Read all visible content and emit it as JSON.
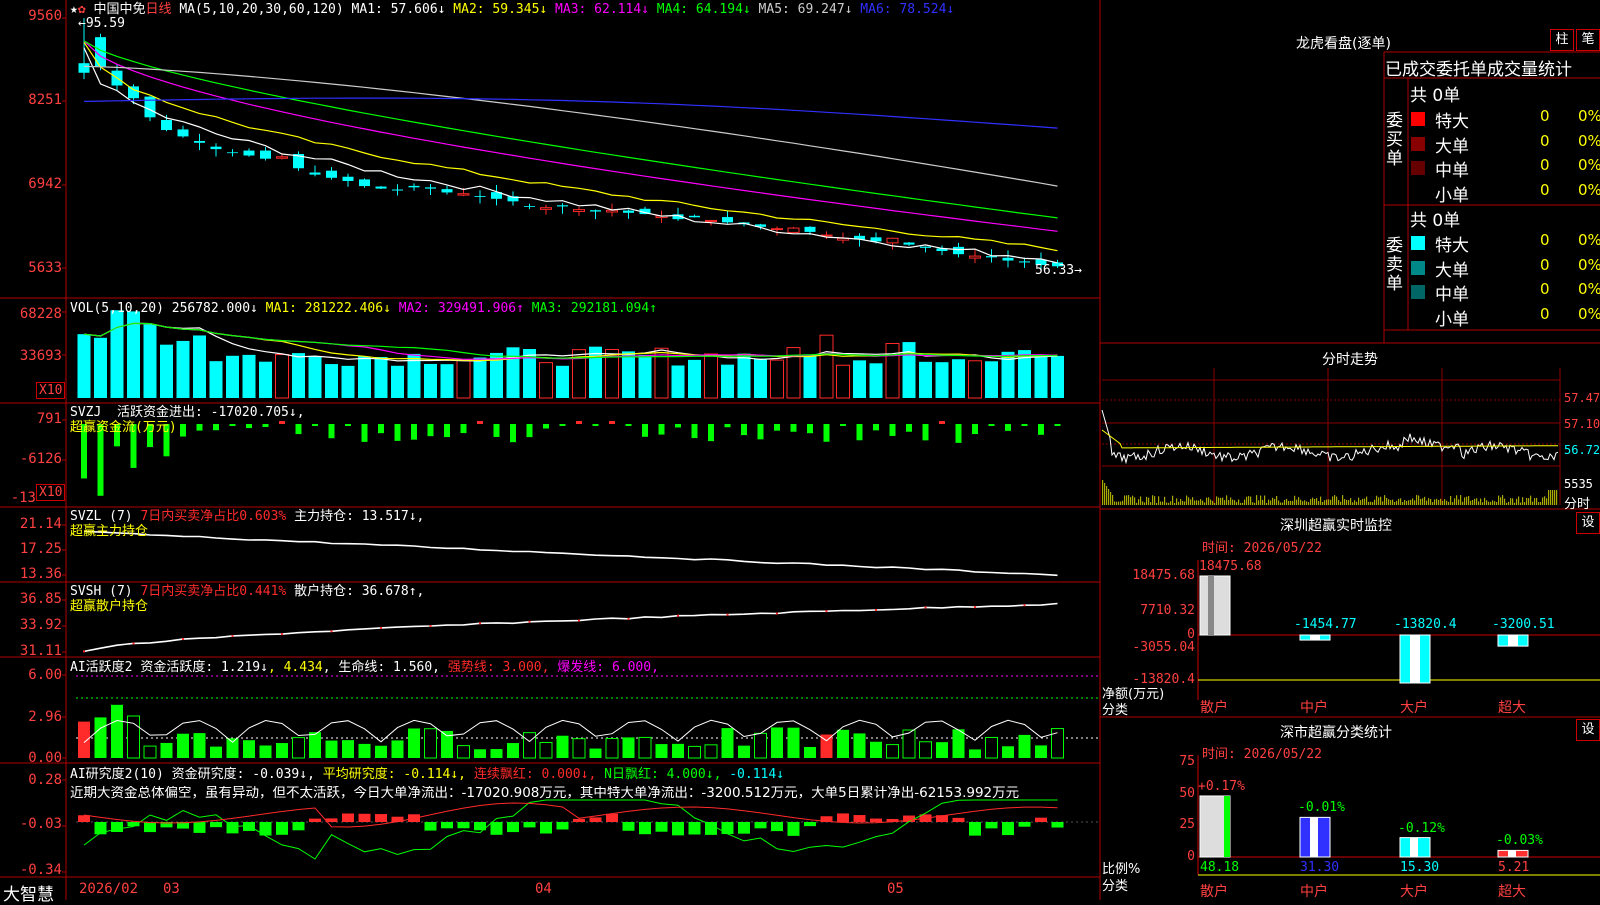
{
  "colors": {
    "up": "#ff2a2a",
    "down": "#00ffff",
    "frame": "#b00000",
    "ma1": "#ffffff",
    "ma2": "#ffff00",
    "ma3": "#ff00ff",
    "ma4": "#00ff00",
    "ma5": "#cccccc",
    "ma6": "#3030ff",
    "yellow": "#ffff00",
    "green": "#00ff00"
  },
  "main": {
    "stock_name": "中国中免",
    "period": "日线",
    "ma_label": "MA(5,10,20,30,60,120)",
    "ma1": "MA1: 57.606↓",
    "ma2": "MA2: 59.345↓",
    "ma3": "MA3: 62.114↓",
    "ma4": "MA4: 64.194↓",
    "ma5": "MA5: 69.247↓",
    "ma6": "MA6: 78.524↓",
    "high_mark": "←95.59",
    "low_mark": "56.33→",
    "yticks": [
      "9560",
      "8251",
      "6942",
      "5633"
    ]
  },
  "vol": {
    "title": "VOL(5,10,20)",
    "value": "256782.000↓",
    "ma1": "MA1: 281222.406↓",
    "ma2": "MA2: 329491.906↑",
    "ma3": "MA3: 292181.094↑",
    "yticks": [
      "68228",
      "33693"
    ],
    "unit": "X10"
  },
  "svzj": {
    "title": "SVZJ",
    "label": "活跃资金进出: -17020.705↓,",
    "sub": "超赢资金流(万元)",
    "yticks": [
      "791",
      "-6126",
      "-13"
    ],
    "unit": "X10"
  },
  "svzl": {
    "title": "SVZL (7)",
    "pct": "7日内买卖净占比0.603%",
    "hold": "主力持仓: 13.517↓,",
    "sub": "超赢主力持仓",
    "yticks": [
      "21.14",
      "17.25",
      "13.36"
    ]
  },
  "svsh": {
    "title": "SVSH (7)",
    "pct": "7日内买卖净占比0.441%",
    "hold": "散户持仓: 36.678↑,",
    "sub": "超赢散户持仓",
    "yticks": [
      "36.85",
      "33.92",
      "31.11"
    ]
  },
  "ai1": {
    "title": "AI活跃度2",
    "fund": "资金活跃度: 1.219↓",
    "v2": "4.434",
    "life": "生命线: 1.560,",
    "strong": "强势线: 3.000,",
    "burst": "爆发线: 6.000,",
    "yticks": [
      "6.00",
      "2.96",
      "0.00"
    ]
  },
  "ai2": {
    "title": "AI研究度2(10)",
    "res": "资金研究度: -0.039↓,",
    "avg": "平均研究度: -0.114↓,",
    "cont": "连续飘红: 0.000↓,",
    "nday": "N日飘红: 4.000↓,",
    "last": "-0.114↓",
    "comment": "近期大资金总体偏空，虽有异动，但不太活跃，今日大单净流出：-17020.908万元，其中特大单净流出：-3200.512万元，大单5日累计净出-62153.992万元",
    "yticks": [
      "0.28",
      "-0.03",
      "-0.34"
    ]
  },
  "xaxis": {
    "brand": "大智慧",
    "labels": [
      "2026/02",
      "03",
      "04",
      "05"
    ]
  },
  "lhb": {
    "title": "龙虎看盘(逐单)",
    "btn1": "柱",
    "btn2": "笔",
    "header": "已成交委托单成交量统计",
    "buy": {
      "side": "委买单",
      "total": "共 0单",
      "rows": [
        {
          "name": "特大",
          "n": "0",
          "pct": "0%"
        },
        {
          "name": "大单",
          "n": "0",
          "pct": "0%"
        },
        {
          "name": "中单",
          "n": "0",
          "pct": "0%"
        },
        {
          "name": "小单",
          "n": "0",
          "pct": "0%"
        }
      ]
    },
    "sell": {
      "side": "委卖单",
      "total": "共 0单",
      "rows": [
        {
          "name": "特大",
          "n": "0",
          "pct": "0%"
        },
        {
          "name": "大单",
          "n": "0",
          "pct": "0%"
        },
        {
          "name": "中单",
          "n": "0",
          "pct": "0%"
        },
        {
          "name": "小单",
          "n": "0",
          "pct": "0%"
        }
      ]
    }
  },
  "fenshi": {
    "title": "分时走势",
    "prices": [
      "57.47",
      "57.10",
      "56.72"
    ],
    "vol": "5535",
    "vol_unit": "分时"
  },
  "monitor": {
    "title": "深圳超赢实时监控",
    "btn": "设",
    "time": "时间: 2026/05/22",
    "unit": "净额(万元)",
    "cat": "分类",
    "yticks": [
      "18475.68",
      "7710.32",
      "0",
      "-3055.04",
      "-13820.4"
    ],
    "bars": [
      {
        "cat": "散户",
        "value": "18475.68"
      },
      {
        "cat": "中户",
        "value": "-1454.77"
      },
      {
        "cat": "大户",
        "value": "-13820.4"
      },
      {
        "cat": "超大",
        "value": "-3200.51"
      }
    ]
  },
  "stats": {
    "title": "深市超赢分类统计",
    "btn": "设",
    "time": "时间: 2026/05/22",
    "unit": "比例%",
    "cat": "分类",
    "yticks": [
      "75",
      "50",
      "25",
      "0"
    ],
    "bars": [
      {
        "cat": "散户",
        "value": "48.18",
        "chg": "+0.17%"
      },
      {
        "cat": "中户",
        "value": "31.30",
        "chg": "-0.01%"
      },
      {
        "cat": "大户",
        "value": "15.30",
        "chg": "-0.12%"
      },
      {
        "cat": "超大",
        "value": "5.21",
        "chg": "-0.03%"
      }
    ]
  }
}
